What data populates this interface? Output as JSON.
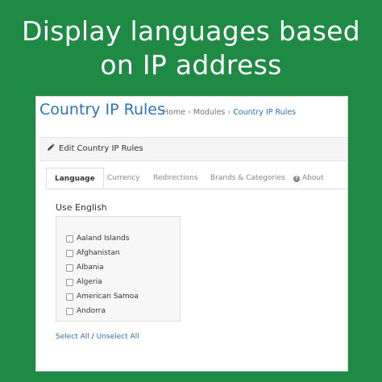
{
  "headline": {
    "line1": "Display languages based",
    "line2": "on IP address"
  },
  "header": {
    "title": "Country IP Rules",
    "breadcrumb": [
      "Home",
      "Modules",
      "Country IP Rules"
    ],
    "separator": "›"
  },
  "panel": {
    "edit_title": "Edit Country IP Rules"
  },
  "tabs": [
    {
      "label": "Language",
      "active": true
    },
    {
      "label": "Currency",
      "active": false
    },
    {
      "label": "Redirections",
      "active": false
    },
    {
      "label": "Brands & Categories",
      "active": false
    },
    {
      "label": "About",
      "active": false
    }
  ],
  "language": {
    "use_label": "Use English",
    "countries": [
      {
        "name": "Aaland Islands",
        "checked": false
      },
      {
        "name": "Afghanistan",
        "checked": false
      },
      {
        "name": "Albania",
        "checked": false
      },
      {
        "name": "Algeria",
        "checked": false
      },
      {
        "name": "American Samoa",
        "checked": false
      },
      {
        "name": "Andorra",
        "checked": false
      }
    ],
    "select_all": "Select All",
    "link_separator": "/",
    "unselect_all": "Unselect All"
  },
  "colors": {
    "background": "#1e8a44",
    "accent": "#2f73b8"
  }
}
